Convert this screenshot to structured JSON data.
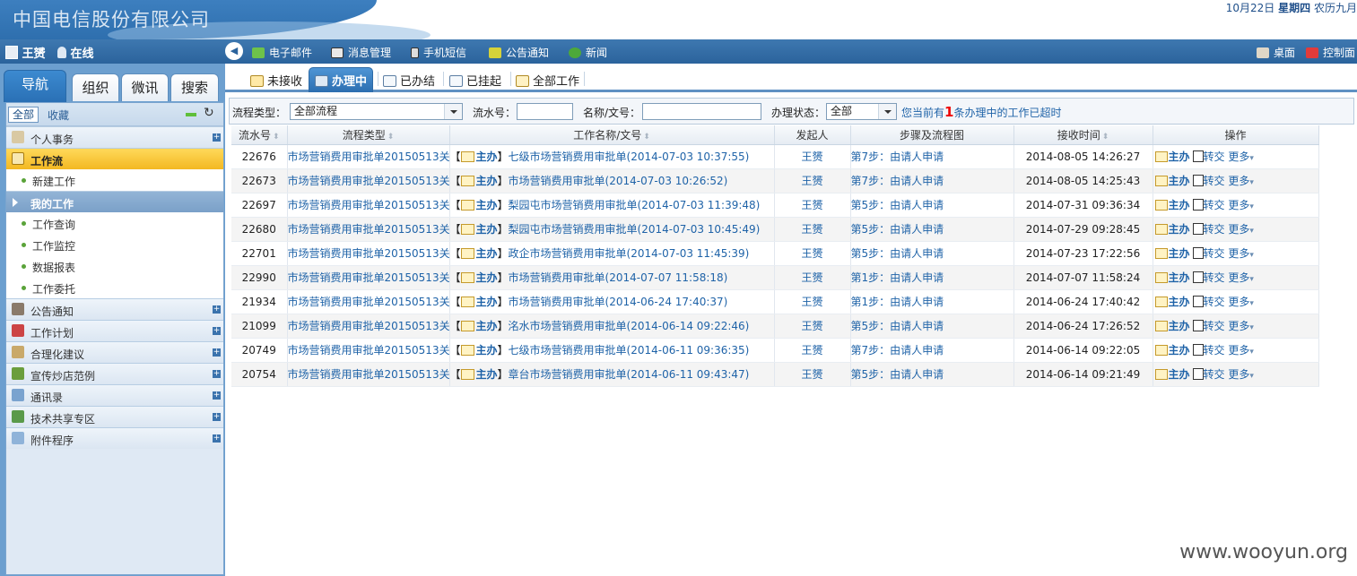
{
  "banner": {
    "company": "中国电信股份有限公司",
    "date": "10月22日",
    "weekday": "星期四",
    "lunar": "农历九月"
  },
  "user": {
    "name": "王赟",
    "status": "在线"
  },
  "left_tabs": [
    "导航",
    "组织",
    "微讯",
    "搜索"
  ],
  "filter": {
    "all": "全部",
    "favorites": "收藏"
  },
  "nav": {
    "personal": "个人事务",
    "workflow": "工作流",
    "new_work": "新建工作",
    "my_work": "我的工作",
    "query": "工作查询",
    "monitor": "工作监控",
    "report": "数据报表",
    "delegate": "工作委托",
    "notice": "公告通知",
    "plan": "工作计划",
    "suggest": "合理化建议",
    "promo": "宣传炒店范例",
    "contacts": "通讯录",
    "tech": "技术共享专区",
    "addons": "附件程序"
  },
  "toolbar": {
    "email": "电子邮件",
    "message": "消息管理",
    "sms": "手机短信",
    "announce": "公告通知",
    "news": "新闻",
    "desktop": "桌面",
    "control": "控制面"
  },
  "worktabs": [
    "未接收",
    "办理中",
    "已办结",
    "已挂起",
    "全部工作"
  ],
  "filterbar": {
    "type_label": "流程类型：",
    "type_value": "全部流程",
    "serial_label": "流水号：",
    "name_label": "名称/文号：",
    "state_label": "办理状态：",
    "state_value": "全部",
    "notice_pre": "您当前有",
    "notice_num": "1",
    "notice_post": "条办理中的工作已超时"
  },
  "table": {
    "headers": [
      "流水号",
      "流程类型",
      "工作名称/文号",
      "发起人",
      "步骤及流程图",
      "接收时间",
      "操作"
    ],
    "tag_open": "【",
    "tag_text": "主办",
    "tag_close": "】",
    "op_main": "主办",
    "op_forward": "转交",
    "op_more": "更多",
    "rows": [
      {
        "id": "22676",
        "type": "市场营销费用审批单20150513关",
        "name": "七级市场营销费用审批单(2014-07-03 10:37:55)",
        "initiator": "王赟",
        "step": "第7步：由请人申请",
        "time": "2014-08-05 14:26:27"
      },
      {
        "id": "22673",
        "type": "市场营销费用审批单20150513关",
        "name": "市场营销费用审批单(2014-07-03 10:26:52)",
        "initiator": "王赟",
        "step": "第7步：由请人申请",
        "time": "2014-08-05 14:25:43"
      },
      {
        "id": "22697",
        "type": "市场营销费用审批单20150513关",
        "name": "梨园屯市场营销费用审批单(2014-07-03 11:39:48)",
        "initiator": "王赟",
        "step": "第5步：由请人申请",
        "time": "2014-07-31 09:36:34"
      },
      {
        "id": "22680",
        "type": "市场营销费用审批单20150513关",
        "name": "梨园屯市场营销费用审批单(2014-07-03 10:45:49)",
        "initiator": "王赟",
        "step": "第5步：由请人申请",
        "time": "2014-07-29 09:28:45"
      },
      {
        "id": "22701",
        "type": "市场营销费用审批单20150513关",
        "name": "政企市场营销费用审批单(2014-07-03 11:45:39)",
        "initiator": "王赟",
        "step": "第5步：由请人申请",
        "time": "2014-07-23 17:22:56"
      },
      {
        "id": "22990",
        "type": "市场营销费用审批单20150513关",
        "name": "市场营销费用审批单(2014-07-07 11:58:18)",
        "initiator": "王赟",
        "step": "第1步：由请人申请",
        "time": "2014-07-07 11:58:24"
      },
      {
        "id": "21934",
        "type": "市场营销费用审批单20150513关",
        "name": "市场营销费用审批单(2014-06-24 17:40:37)",
        "initiator": "王赟",
        "step": "第1步：由请人申请",
        "time": "2014-06-24 17:40:42"
      },
      {
        "id": "21099",
        "type": "市场营销费用审批单20150513关",
        "name": "洺水市场营销费用审批单(2014-06-14 09:22:46)",
        "initiator": "王赟",
        "step": "第5步：由请人申请",
        "time": "2014-06-24 17:26:52"
      },
      {
        "id": "20749",
        "type": "市场营销费用审批单20150513关",
        "name": "七级市场营销费用审批单(2014-06-11 09:36:35)",
        "initiator": "王赟",
        "step": "第7步：由请人申请",
        "time": "2014-06-14 09:22:05"
      },
      {
        "id": "20754",
        "type": "市场营销费用审批单20150513关",
        "name": "章台市场营销费用审批单(2014-06-11 09:43:47)",
        "initiator": "王赟",
        "step": "第5步：由请人申请",
        "time": "2014-06-14 09:21:49"
      }
    ]
  },
  "watermark": "www.wooyun.org",
  "colors": {
    "brand_blue": "#2b639c",
    "highlight": "#f3b822",
    "link": "#1f63a8",
    "alert": "#ee0000"
  }
}
